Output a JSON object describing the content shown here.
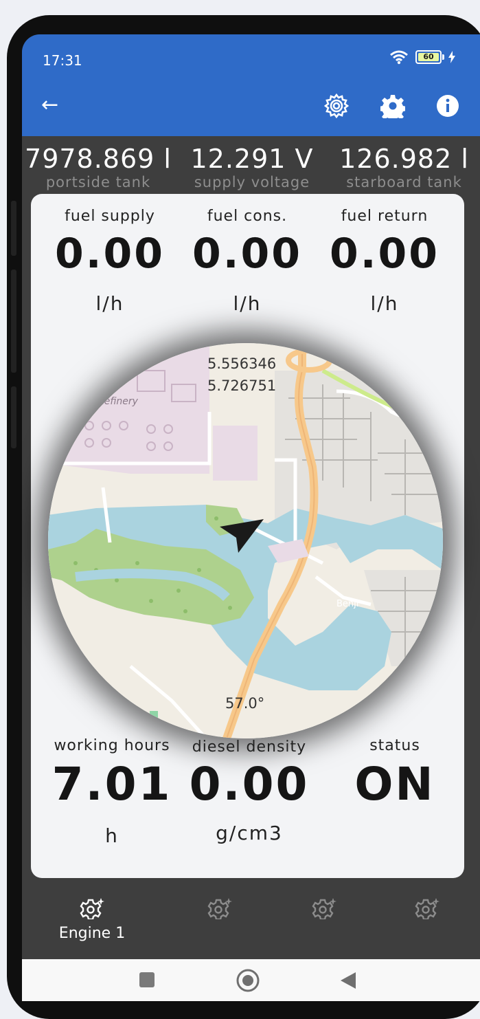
{
  "status_bar": {
    "time": "17:31",
    "battery": "60"
  },
  "app_bar": {
    "back": "←"
  },
  "tanks": [
    {
      "value": "7978.869 l",
      "label": "portside tank"
    },
    {
      "value": "12.291 V",
      "label": "supply voltage"
    },
    {
      "value": "126.982 l",
      "label": "starboard tank"
    }
  ],
  "flow": [
    {
      "label": "fuel supply",
      "value": "0.00",
      "unit": "l/h"
    },
    {
      "label": "fuel cons.",
      "value": "0.00",
      "unit": "l/h"
    },
    {
      "label": "fuel return",
      "value": "0.00",
      "unit": "l/h"
    }
  ],
  "map": {
    "lat": "5.556346",
    "lon": "5.726751",
    "heading": "57.0°",
    "place_refinery": "Refinery",
    "place_benji": "Benji"
  },
  "stats": [
    {
      "label": "working hours",
      "value": "7.01",
      "unit": "h"
    },
    {
      "label": "diesel density",
      "value": "0.00",
      "unit": "g/cm3"
    },
    {
      "label": "status",
      "value": "ON",
      "unit": ""
    }
  ],
  "bottom_nav": [
    {
      "label": "Engine 1",
      "icon": "engine-gear-icon"
    },
    {
      "label": "",
      "icon": "engine-gear-icon"
    },
    {
      "label": "",
      "icon": "engine-gear-icon"
    },
    {
      "label": "",
      "icon": "engine-gear-icon"
    }
  ],
  "colors": {
    "app_bar": "#2f6bc8",
    "background": "#3e3e3e",
    "card": "#f3f4f6"
  }
}
